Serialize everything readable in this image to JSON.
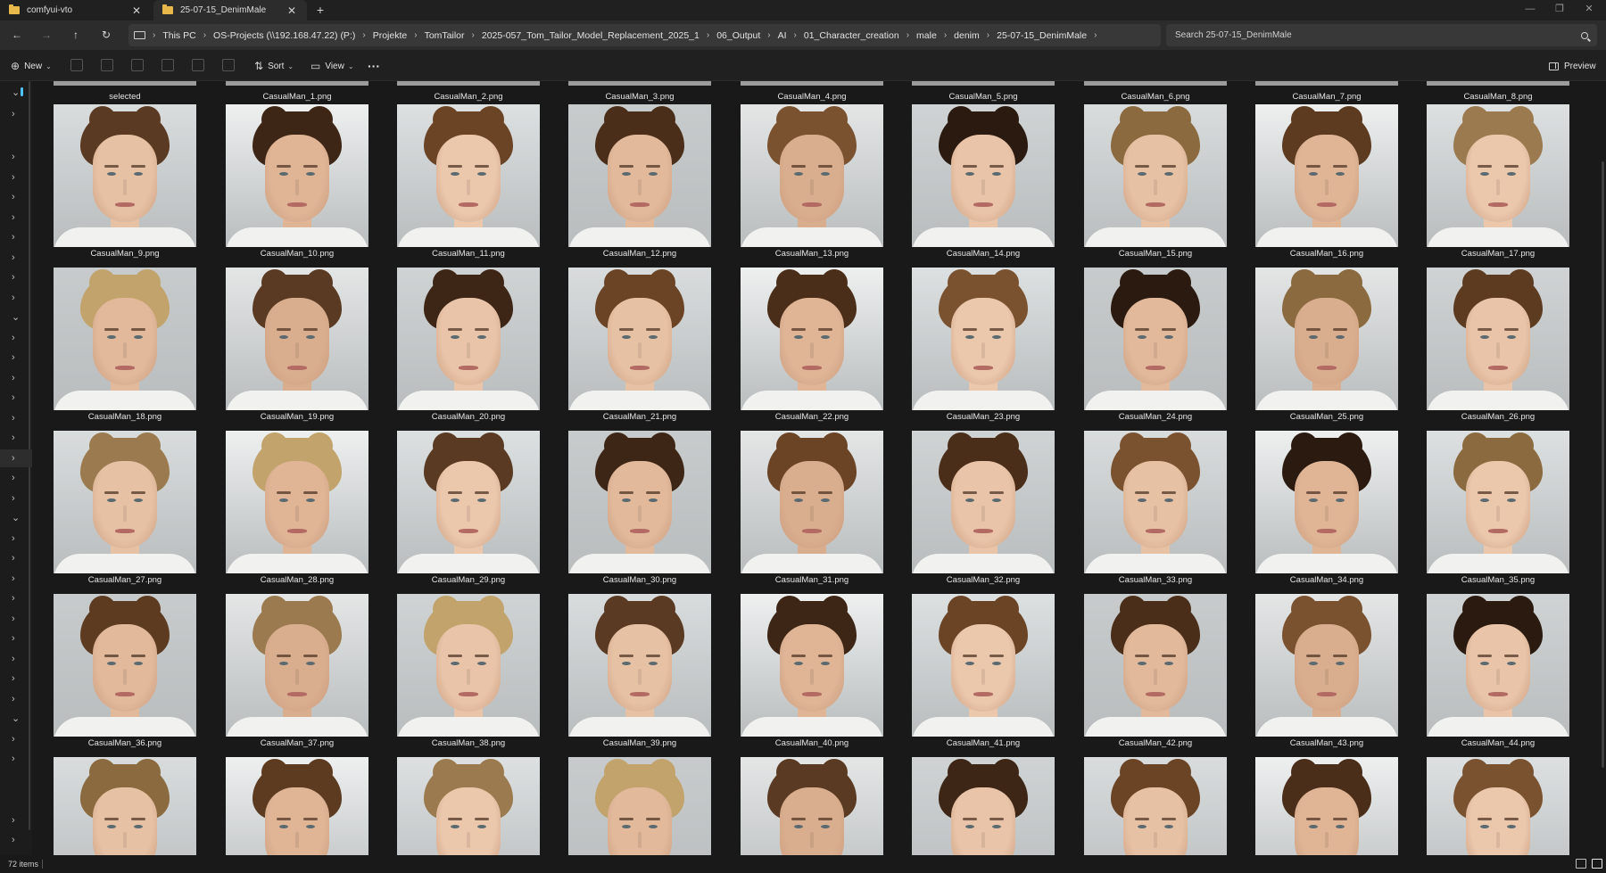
{
  "tabs": [
    {
      "label": "comfyui-vto",
      "close": "✕"
    },
    {
      "label": "25-07-15_DenimMale",
      "close": "✕"
    }
  ],
  "new_tab": "+",
  "window_controls": {
    "minimize": "—",
    "maximize": "❐",
    "close": "✕"
  },
  "nav": {
    "back": "←",
    "forward": "→",
    "up": "↑",
    "refresh": "↻",
    "expand": "›"
  },
  "breadcrumbs": [
    "This PC",
    "OS-Projects (\\\\192.168.47.22) (P:)",
    "Projekte",
    "TomTailor",
    "2025-057_Tom_Tailor_Model_Replacement_2025_1",
    "06_Output",
    "AI",
    "01_Character_creation",
    "male",
    "denim",
    "25-07-15_DenimMale"
  ],
  "breadcrumb_sep": "›",
  "search": {
    "placeholder": "Search 25-07-15_DenimMale"
  },
  "toolbar": {
    "new_label": "New",
    "sort_label": "Sort",
    "view_label": "View",
    "more_label": "···",
    "preview_label": "Preview",
    "new_glyph": "⊕",
    "sort_glyph": "⇅",
    "view_glyph": "▭",
    "caret": "⌄"
  },
  "nav_pane": {
    "expanded": "⌄",
    "collapsed": "›"
  },
  "top_row_captions": [
    "selected",
    "CasualMan_1.png",
    "CasualMan_2.png",
    "CasualMan_3.png",
    "CasualMan_4.png",
    "CasualMan_5.png",
    "CasualMan_6.png",
    "CasualMan_7.png",
    "CasualMan_8.png"
  ],
  "files": [
    "CasualMan_9.png",
    "CasualMan_10.png",
    "CasualMan_11.png",
    "CasualMan_12.png",
    "CasualMan_13.png",
    "CasualMan_14.png",
    "CasualMan_15.png",
    "CasualMan_16.png",
    "CasualMan_17.png",
    "CasualMan_18.png",
    "CasualMan_19.png",
    "CasualMan_20.png",
    "CasualMan_21.png",
    "CasualMan_22.png",
    "CasualMan_23.png",
    "CasualMan_24.png",
    "CasualMan_25.png",
    "CasualMan_26.png",
    "CasualMan_27.png",
    "CasualMan_28.png",
    "CasualMan_29.png",
    "CasualMan_30.png",
    "CasualMan_31.png",
    "CasualMan_32.png",
    "CasualMan_33.png",
    "CasualMan_34.png",
    "CasualMan_35.png",
    "CasualMan_36.png",
    "CasualMan_37.png",
    "CasualMan_38.png",
    "CasualMan_39.png",
    "CasualMan_40.png",
    "CasualMan_41.png",
    "CasualMan_42.png",
    "CasualMan_43.png",
    "CasualMan_44.png"
  ],
  "status": {
    "item_count": "72 items"
  },
  "colors": {
    "accent": "#4cc2ff",
    "folder": "#e8b84a",
    "background": "#191919"
  }
}
